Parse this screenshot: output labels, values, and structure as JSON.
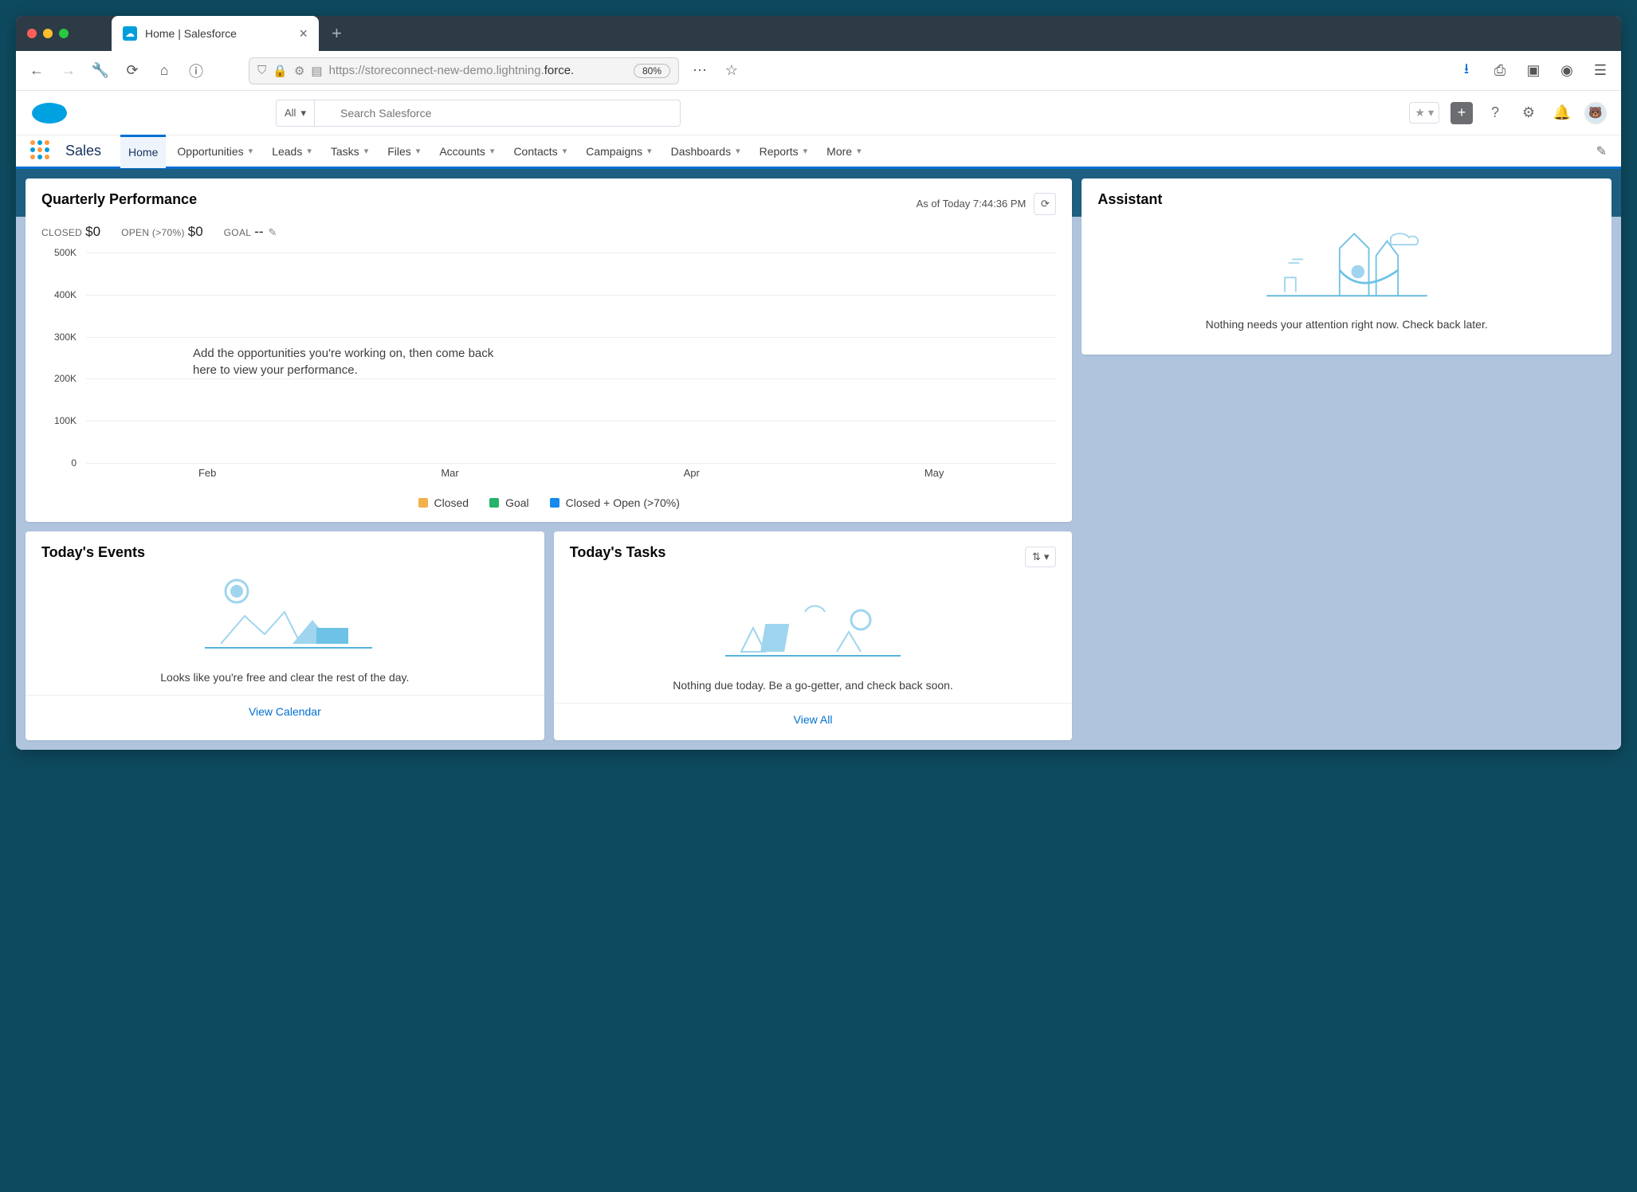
{
  "browser": {
    "tab_title": "Home | Salesforce",
    "url_prefix": "https://storeconnect-new-demo.lightning.",
    "url_bold": "force.",
    "zoom": "80%"
  },
  "header": {
    "search_scope": "All",
    "search_placeholder": "Search Salesforce"
  },
  "nav": {
    "app_name": "Sales",
    "items": [
      {
        "label": "Home",
        "dropdown": false,
        "active": true
      },
      {
        "label": "Opportunities",
        "dropdown": true
      },
      {
        "label": "Leads",
        "dropdown": true
      },
      {
        "label": "Tasks",
        "dropdown": true
      },
      {
        "label": "Files",
        "dropdown": true
      },
      {
        "label": "Accounts",
        "dropdown": true
      },
      {
        "label": "Contacts",
        "dropdown": true
      },
      {
        "label": "Campaigns",
        "dropdown": true
      },
      {
        "label": "Dashboards",
        "dropdown": true
      },
      {
        "label": "Reports",
        "dropdown": true
      },
      {
        "label": "More",
        "dropdown": true
      }
    ]
  },
  "quarterly": {
    "title": "Quarterly Performance",
    "timestamp": "As of Today 7:44:36 PM",
    "closed_label": "CLOSED",
    "closed_value": "$0",
    "open_label": "OPEN (>70%)",
    "open_value": "$0",
    "goal_label": "GOAL",
    "goal_value": "--",
    "empty_msg": "Add the opportunities you're working on, then come back here to view your performance."
  },
  "chart_data": {
    "type": "line",
    "categories": [
      "Feb",
      "Mar",
      "Apr",
      "May"
    ],
    "series": [
      {
        "name": "Closed",
        "values": [
          0,
          0,
          0,
          0
        ],
        "color": "#f2b14b"
      },
      {
        "name": "Goal",
        "values": [
          0,
          0,
          0,
          0
        ],
        "color": "#24b36b"
      },
      {
        "name": "Closed + Open (>70%)",
        "values": [
          0,
          0,
          0,
          0
        ],
        "color": "#1589ee"
      }
    ],
    "ylabel": "",
    "xlabel": "",
    "ylim": [
      0,
      500000
    ],
    "yticks": [
      "0",
      "100K",
      "200K",
      "300K",
      "400K",
      "500K"
    ]
  },
  "events": {
    "title": "Today's Events",
    "empty_msg": "Looks like you're free and clear the rest of the day.",
    "footer_link": "View Calendar"
  },
  "tasks": {
    "title": "Today's Tasks",
    "empty_msg": "Nothing due today. Be a go-getter, and check back soon.",
    "footer_link": "View All"
  },
  "assistant": {
    "title": "Assistant",
    "empty_msg": "Nothing needs your attention right now. Check back later."
  }
}
